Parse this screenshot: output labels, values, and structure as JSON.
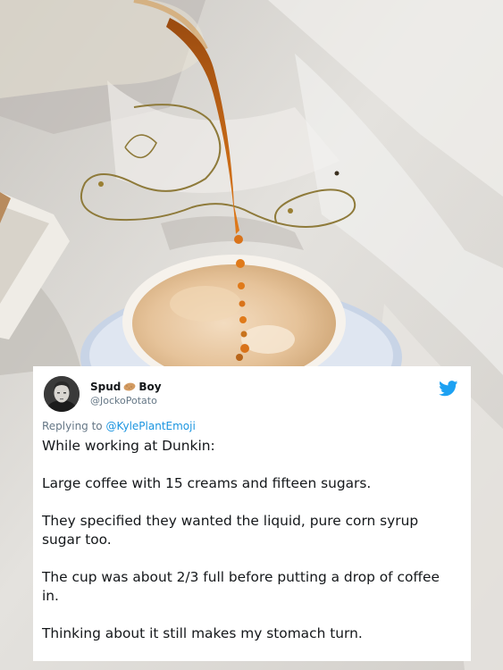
{
  "tweet": {
    "display_name_part1": "Spud",
    "display_name_part2": "Boy",
    "handle": "@JockoPotato",
    "reply_prefix": "Replying to",
    "reply_mention": "@KylePlantEmoji",
    "paragraphs": [
      "While working at Dunkin:",
      "Large coffee with 15 creams and fifteen sugars.",
      "They specified they wanted the liquid, pure corn syrup sugar too.",
      "The cup was about 2/3 full before putting a drop of coffee in.",
      "Thinking about it still makes my stomach turn."
    ]
  },
  "icons": {
    "avatar": "profile-photo",
    "name_emoji": "potato-emoji",
    "brand": "twitter-bird-icon"
  },
  "colors": {
    "twitter_blue": "#1da1f2",
    "mention_blue": "#1b95e0",
    "text_primary": "#14171a",
    "text_secondary": "#657786",
    "card_background": "#ffffff",
    "coffee_foam": "#e8c9a3",
    "coffee_stream": "#c8731e"
  }
}
